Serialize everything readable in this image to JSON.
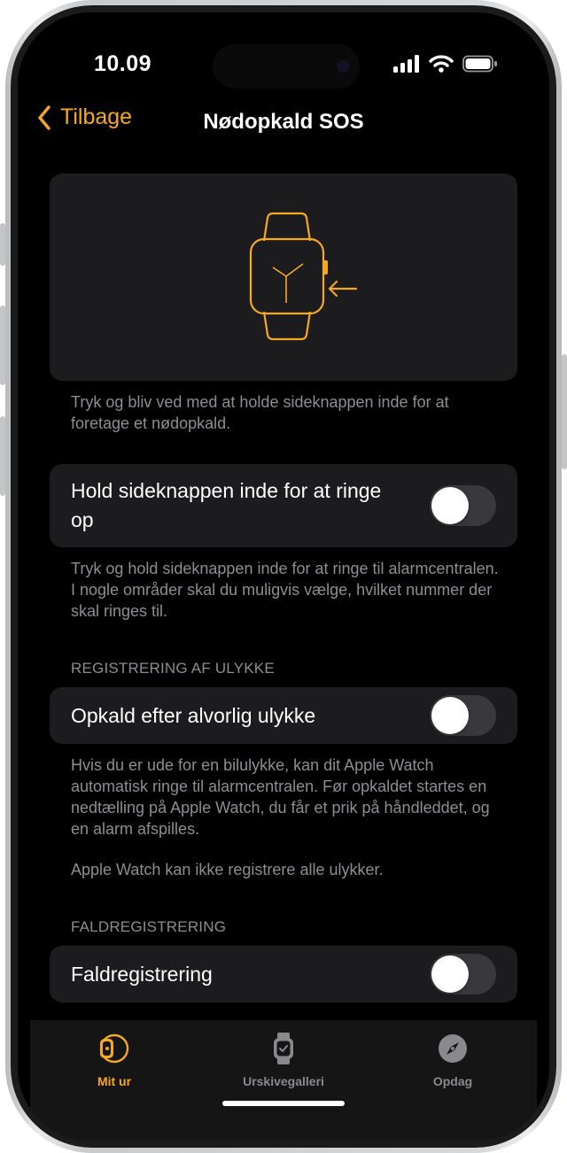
{
  "status_bar": {
    "time": "10.09"
  },
  "nav": {
    "back_label": "Tilbage",
    "title": "Nødopkald SOS"
  },
  "hero": {
    "description": "Tryk og bliv ved med at holde sideknappen inde for at foretage et nødopkald."
  },
  "side_button_row": {
    "label": "Hold sideknappen inde for at ringe op",
    "toggle_on": false,
    "footnote": "Tryk og hold sideknappen inde for at ringe til alarmcentralen. I nogle områder skal du muligvis vælge, hvilket nummer der skal ringes til."
  },
  "crash_section": {
    "header": "REGISTRERING AF ULYKKE",
    "row_label": "Opkald efter alvorlig ulykke",
    "toggle_on": false,
    "footnote_1": "Hvis du er ude for en bilulykke, kan dit Apple Watch automatisk ringe til alarmcentralen. Før opkaldet startes en nedtælling på Apple Watch, du får et prik på håndleddet, og en alarm afspilles.",
    "footnote_2": "Apple Watch kan ikke registrere alle ulykker."
  },
  "fall_section": {
    "header": "FALDREGISTRERING",
    "row_label": "Faldregistrering",
    "toggle_on": false
  },
  "tabs": [
    {
      "label": "Mit ur",
      "icon": "watch-icon",
      "active": true
    },
    {
      "label": "Urskivegalleri",
      "icon": "watch-face-gallery-icon",
      "active": false
    },
    {
      "label": "Opdag",
      "icon": "compass-icon",
      "active": false
    }
  ],
  "colors": {
    "accent": "#f6a821",
    "background": "#000000",
    "card": "#1c1c1e",
    "secondary_text": "#8d8d93",
    "toggle_off": "#39393d",
    "tab_inactive": "#8a8a8e"
  }
}
